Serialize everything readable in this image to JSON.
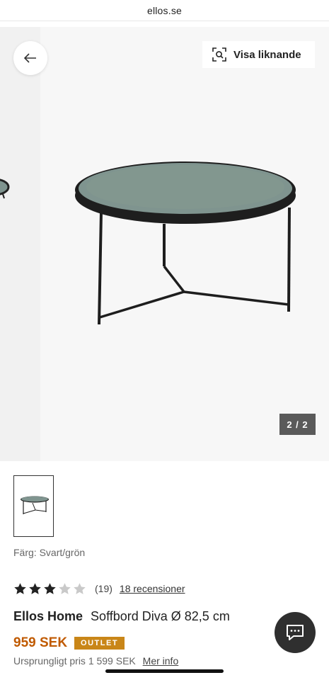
{
  "browser": {
    "url": "ellos.se"
  },
  "gallery": {
    "similar_label": "Visa liknande",
    "counter": "2 / 2"
  },
  "product": {
    "color_label": "Färg: Svart/grön",
    "rating": {
      "value": 3,
      "max": 5,
      "count": "(19)",
      "reviews_label": "18 recensioner"
    },
    "brand": "Ellos Home",
    "name": "Soffbord Diva Ø 82,5 cm",
    "price": "959 SEK",
    "badge": "OUTLET",
    "original_price": "Ursprungligt pris 1 599 SEK",
    "more_info_label": "Mer info"
  },
  "colors": {
    "price": "#c05a00",
    "badge_bg": "#c98618",
    "table_top": "#7f948f",
    "frame": "#1e1e1e"
  },
  "icons": {
    "back": "arrow-left-icon",
    "similar": "visual-search-icon",
    "chat": "chat-icon",
    "star": "star-icon"
  }
}
